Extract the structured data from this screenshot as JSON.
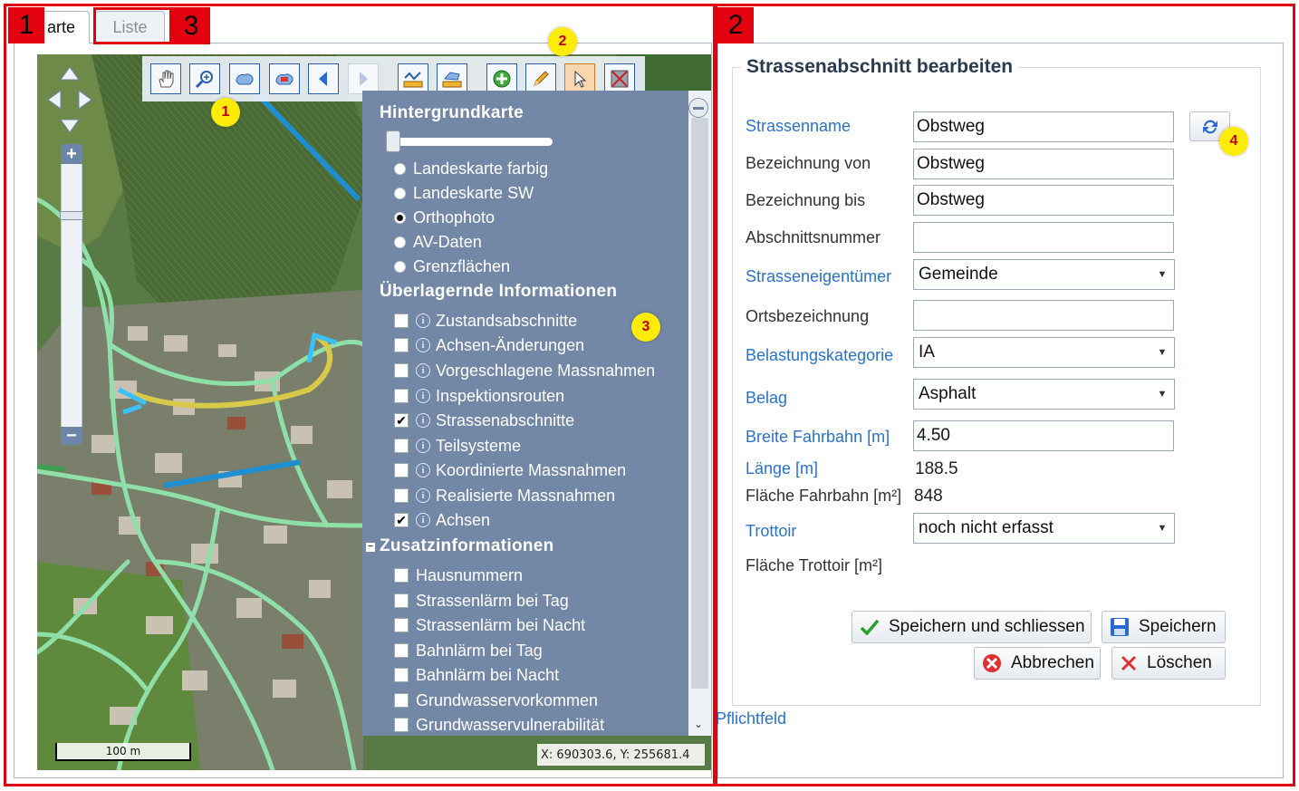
{
  "annotations": {
    "frame_numbers": [
      "1",
      "2",
      "3"
    ],
    "callouts": [
      "1",
      "2",
      "3",
      "4"
    ]
  },
  "tabs": [
    {
      "label": "arte",
      "active": true
    },
    {
      "label": "Liste",
      "active": false
    }
  ],
  "map": {
    "toolbar_icons": [
      "pan-hand-icon",
      "zoom-box-icon",
      "zoom-full-icon",
      "zoom-layer-icon",
      "previous-view-icon",
      "next-view-icon",
      "measure-distance-icon",
      "measure-area-icon",
      "add-feature-icon",
      "edit-feature-icon",
      "select-feature-icon",
      "delete-feature-icon"
    ],
    "scale_label": "100 m",
    "coordinates": "X: 690303.6, Y: 255681.4"
  },
  "layers": {
    "background_title": "Hintergrundkarte",
    "background_options": [
      {
        "label": "Landeskarte farbig",
        "selected": false
      },
      {
        "label": "Landeskarte SW",
        "selected": false
      },
      {
        "label": "Orthophoto",
        "selected": true
      },
      {
        "label": "AV-Daten",
        "selected": false
      },
      {
        "label": "Grenzflächen",
        "selected": false
      }
    ],
    "overlay_title": "Überlagernde Informationen",
    "overlays": [
      {
        "label": "Zustandsabschnitte",
        "checked": false
      },
      {
        "label": "Achsen-Änderungen",
        "checked": false
      },
      {
        "label": "Vorgeschlagene Massnahmen",
        "checked": false
      },
      {
        "label": "Inspektionsrouten",
        "checked": false
      },
      {
        "label": "Strassenabschnitte",
        "checked": true
      },
      {
        "label": "Teilsysteme",
        "checked": false
      },
      {
        "label": "Koordinierte Massnahmen",
        "checked": false
      },
      {
        "label": "Realisierte Massnahmen",
        "checked": false
      },
      {
        "label": "Achsen",
        "checked": true
      }
    ],
    "additional_title": "Zusatzinformationen",
    "additional": [
      {
        "label": "Hausnummern",
        "checked": false
      },
      {
        "label": "Strassenlärm bei Tag",
        "checked": false
      },
      {
        "label": "Strassenlärm bei Nacht",
        "checked": false
      },
      {
        "label": "Bahnlärm bei Tag",
        "checked": false
      },
      {
        "label": "Bahnlärm bei Nacht",
        "checked": false
      },
      {
        "label": "Grundwasservorkommen",
        "checked": false
      },
      {
        "label": "Grundwasservulnerabilität",
        "checked": false
      }
    ]
  },
  "form": {
    "title": "Strassenabschnitt bearbeiten",
    "strassenname_label": "Strassenname",
    "strassenname_value": "Obstweg",
    "bezeichnung_von_label": "Bezeichnung von",
    "bezeichnung_von_value": "Obstweg",
    "bezeichnung_bis_label": "Bezeichnung bis",
    "bezeichnung_bis_value": "Obstweg",
    "abschnittsnummer_label": "Abschnittsnummer",
    "abschnittsnummer_value": "",
    "eigentuemer_label": "Strasseneigentümer",
    "eigentuemer_value": "Gemeinde",
    "ortsbezeichnung_label": "Ortsbezeichnung",
    "ortsbezeichnung_value": "",
    "belastung_label": "Belastungskategorie",
    "belastung_value": "IA",
    "belag_label": "Belag",
    "belag_value": "Asphalt",
    "breite_label": "Breite Fahrbahn [m]",
    "breite_value": "4.50",
    "laenge_label": "Länge [m]",
    "laenge_value": "188.5",
    "flaeche_label": "Fläche Fahrbahn [m²]",
    "flaeche_value": "848",
    "trottoir_label": "Trottoir",
    "trottoir_value": "noch nicht erfasst",
    "flaeche_trottoir_label": "Fläche Trottoir [m²]",
    "save_close_label": "Speichern und schliessen",
    "save_label": "Speichern",
    "cancel_label": "Abbrechen",
    "delete_label": "Löschen",
    "required_note": "Pflichtfeld"
  },
  "colors": {
    "annotation_red": "#e3000f",
    "callout_yellow": "#ffeb0a",
    "link_blue": "#2a72c8",
    "panel_blue": "#7388a6"
  }
}
